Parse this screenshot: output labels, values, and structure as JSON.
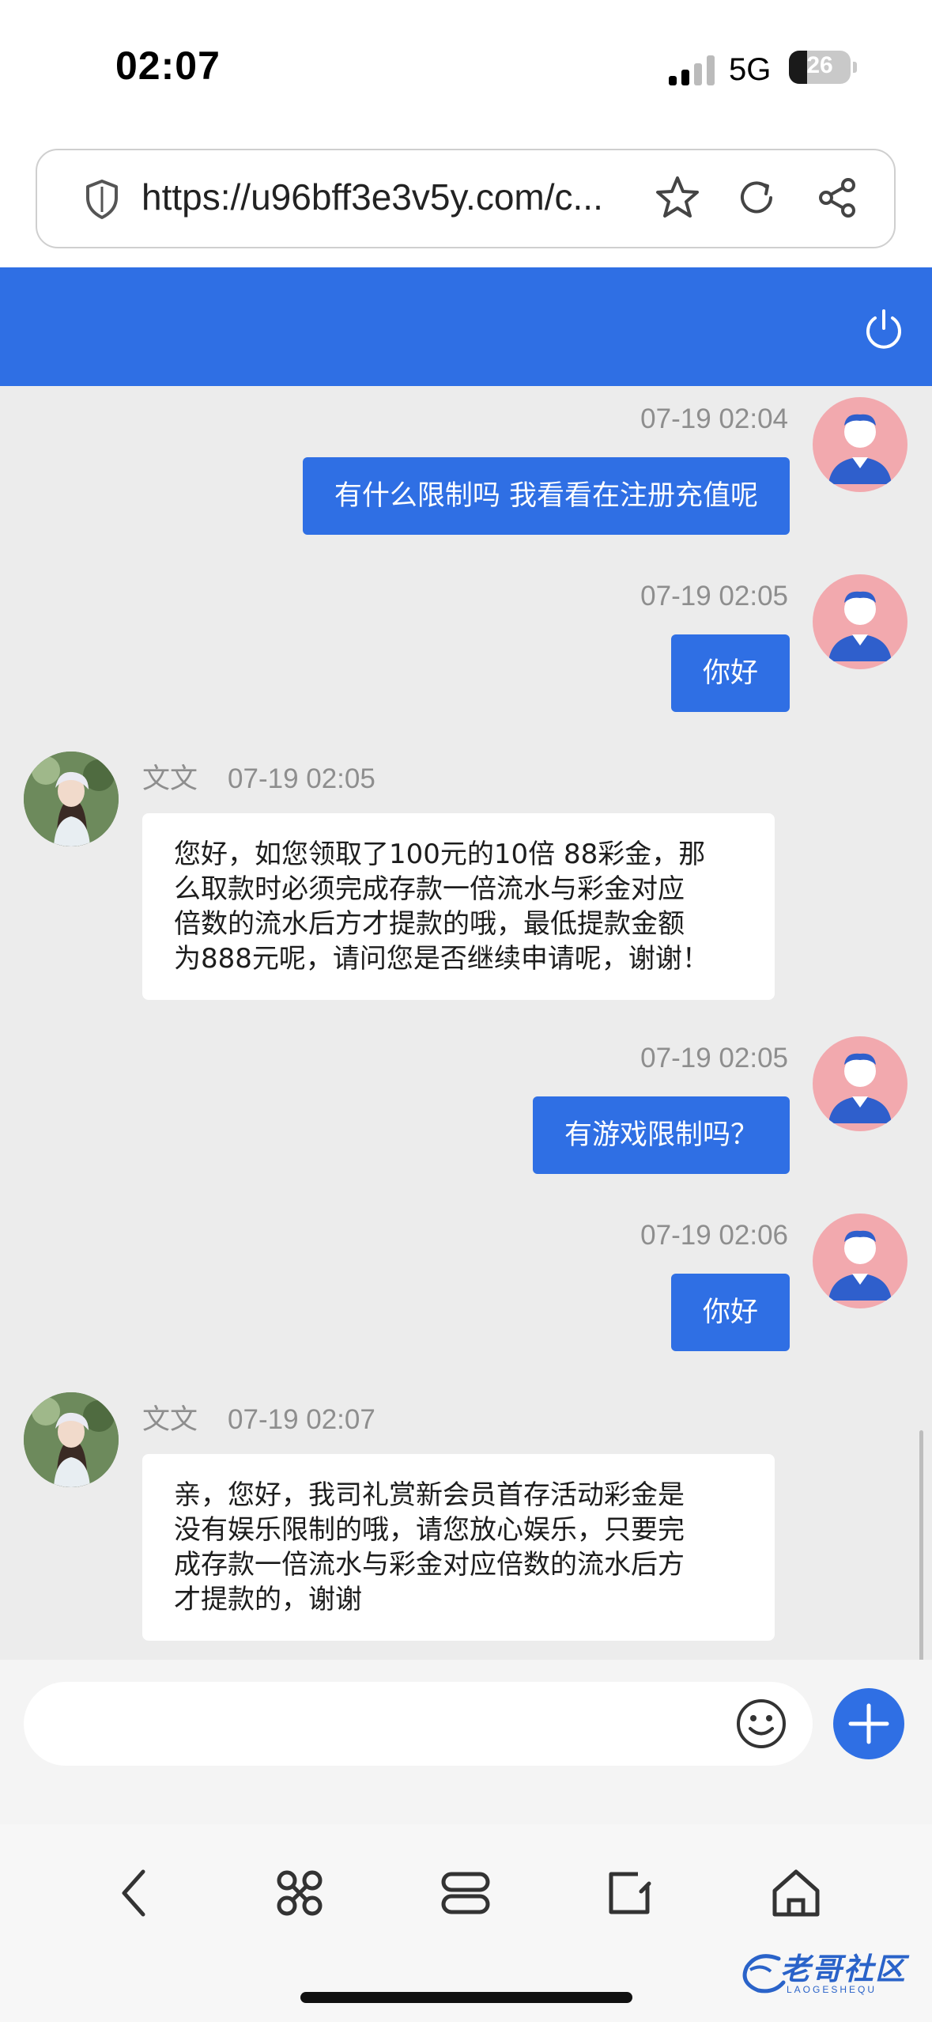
{
  "status_bar": {
    "time": "02:07",
    "network": "5G",
    "battery": "26"
  },
  "browser": {
    "url": "https://u96bff3e3v5y.com/c..."
  },
  "colors": {
    "accent": "#2f6fe4",
    "chat_bg": "#ececec",
    "user_avatar_bg": "#f2a9ae"
  },
  "messages": [
    {
      "sender": "user",
      "time": "07-19 02:04",
      "text": "有什么限制吗 我看看在注册充值呢"
    },
    {
      "sender": "user",
      "time": "07-19 02:05",
      "text": "你好"
    },
    {
      "sender": "agent",
      "name": "文文",
      "time": "07-19 02:05",
      "lines": [
        "您好，如您领取了100元的10倍 88彩金，那",
        "么取款时必须完成存款一倍流水与彩金对应",
        "倍数的流水后方才提款的哦，最低提款金额",
        "为888元呢，请问您是否继续申请呢，谢谢！"
      ]
    },
    {
      "sender": "user",
      "time": "07-19 02:05",
      "text": "有游戏限制吗？"
    },
    {
      "sender": "user",
      "time": "07-19 02:06",
      "text": "你好"
    },
    {
      "sender": "agent",
      "name": "文文",
      "time": "07-19 02:07",
      "lines": [
        "亲，您好，我司礼赏新会员首存活动彩金是",
        "没有娱乐限制的哦，请您放心娱乐，只要完",
        "成存款一倍流水与彩金对应倍数的流水后方",
        "才提款的，谢谢"
      ]
    }
  ],
  "input": {
    "placeholder": ""
  },
  "watermark": {
    "text": "老哥社区",
    "sub": "LAOGESHEQU"
  },
  "icons": {
    "url": [
      "shield-icon",
      "star-icon",
      "reload-icon",
      "share-icon"
    ],
    "header": "power-icon",
    "input": [
      "emoji-icon",
      "plus-icon"
    ],
    "nav": [
      "back-icon",
      "command-icon",
      "tabs-icon",
      "edit-icon",
      "home-icon"
    ]
  }
}
